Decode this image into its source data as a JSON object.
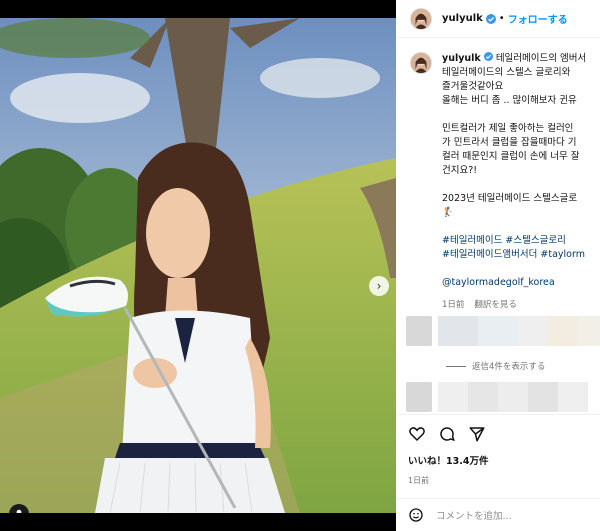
{
  "post": {
    "username": "yulyulk",
    "follow_label": "フォローする",
    "caption_lines": [
      "테일러메이드의 엠버서",
      "테일러메이드의 스텔스 글로리와",
      "즐거울것같아요",
      "올해는 버디 좀 .. 많이해보자 귄유"
    ],
    "caption_lines_2": [
      "민트컬러가 제일 좋아하는 컬러인",
      "가 민트라서 클럽을 잡을때마다 기",
      "컬러 때문인지 클럽이 손에 너무 잘",
      "건지요?!"
    ],
    "caption_line_3": "2023년 테일러메이드 스텔스글로",
    "hashtags_1": "#테일러메이드 #스텔스글로리",
    "hashtags_2": "#테일러메이드앰버서더 #taylorm",
    "mention": "@taylormadegolf_korea",
    "time_ago": "1日前",
    "translate_label": "翻訳を見る",
    "replies_label": "返信4件を表示する",
    "likes": "いいね！13.4万件",
    "date": "1日前",
    "comment_placeholder": "コメントを追加..."
  },
  "colors": {
    "link": "#0095f6",
    "hashtag": "#00376b",
    "muted": "#737373",
    "club_head": "#5fc9c0"
  },
  "icons": {
    "verified": "verified-badge-icon",
    "next": "chevron-right-icon",
    "tag": "user-tag-icon",
    "like": "heart-icon",
    "comment": "comment-icon",
    "share": "send-icon",
    "emoji": "emoji-icon"
  }
}
